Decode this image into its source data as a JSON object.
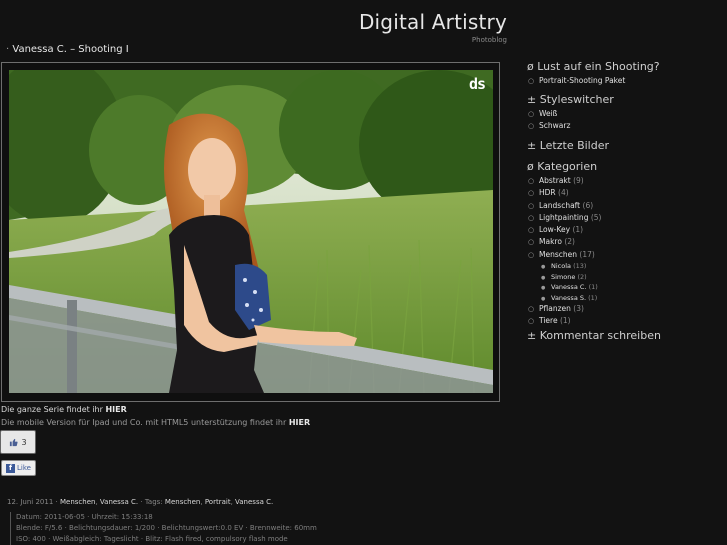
{
  "site": {
    "title": "Digital Artistry",
    "subtitle": "Photoblog"
  },
  "post": {
    "title_prefix": "·",
    "title": "Vanessa C. – Shooting I",
    "logo_text": "ds",
    "series_text": "Die ganze Serie findet ihr",
    "series_link": "HIER",
    "mobile_text": "Die mobile Version für Ipad und Co. mit HTML5 unterstützung findet ihr",
    "mobile_link": "HIER",
    "like_count": "3",
    "like_label": "Like",
    "fb_letter": "f",
    "date": "12. Juni 2011",
    "sep1": "·",
    "categories": [
      "Menschen",
      "Vanessa C."
    ],
    "sep2": "·",
    "tags_label": "Tags:",
    "tags": [
      "Menschen",
      "Portrait",
      "Vanessa C."
    ],
    "exif": [
      "Datum: 2011-06-05 · Uhrzeit: 15:33:18",
      "Blende: F/5.6 · Belichtungsdauer: 1/200 · Belichtungswert:0.0 EV · Brennweite: 60mm",
      "ISO: 400 · Weißabgleich: Tageslicht · Blitz: Flash fired, compulsory flash mode"
    ]
  },
  "sidebar": {
    "shooting": {
      "title": "ø Lust auf ein Shooting?",
      "items": [
        "Portrait-Shooting Paket"
      ]
    },
    "styles": {
      "title": "± Styleswitcher",
      "items": [
        "Weiß",
        "Schwarz"
      ]
    },
    "recent": {
      "title": "± Letzte Bilder"
    },
    "categories": {
      "title": "ø Kategorien",
      "items": [
        {
          "name": "Abstrakt",
          "count": "(9)"
        },
        {
          "name": "HDR",
          "count": "(4)"
        },
        {
          "name": "Landschaft",
          "count": "(6)"
        },
        {
          "name": "Lightpainting",
          "count": "(5)"
        },
        {
          "name": "Low-Key",
          "count": "(1)"
        },
        {
          "name": "Makro",
          "count": "(2)"
        },
        {
          "name": "Menschen",
          "count": "(17)"
        }
      ],
      "subitems": [
        {
          "name": "Nicola",
          "count": "(13)"
        },
        {
          "name": "Simone",
          "count": "(2)"
        },
        {
          "name": "Vanessa C.",
          "count": "(1)"
        },
        {
          "name": "Vanessa S.",
          "count": "(1)"
        }
      ],
      "items_after": [
        {
          "name": "Pflanzen",
          "count": "(3)"
        },
        {
          "name": "Tiere",
          "count": "(1)"
        }
      ]
    },
    "comment": {
      "title": "± Kommentar schreiben"
    }
  }
}
